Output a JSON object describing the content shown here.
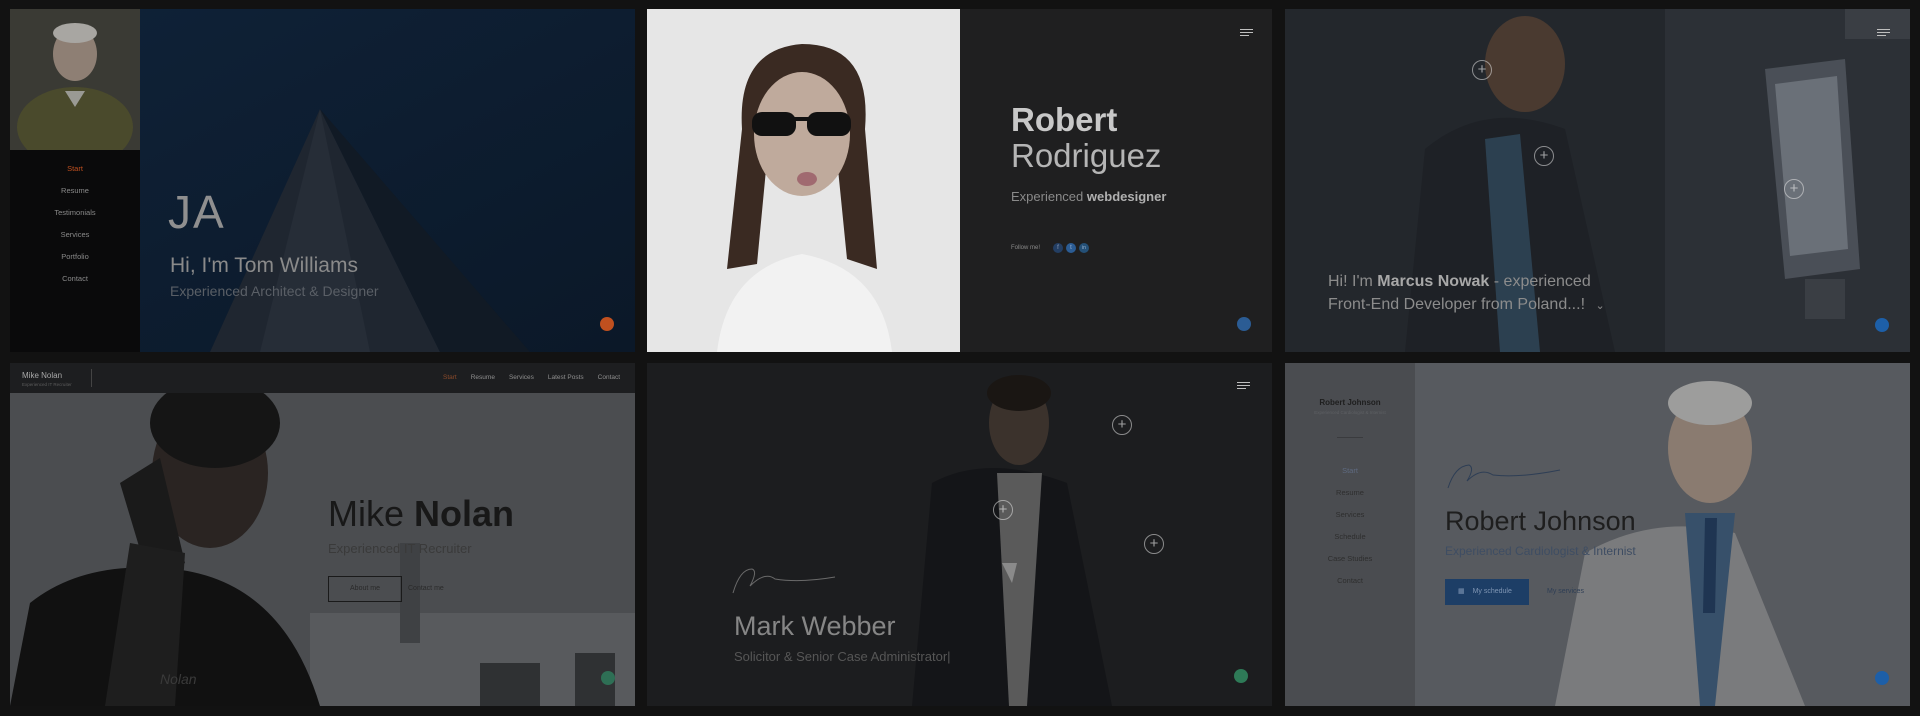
{
  "tiles": {
    "tom": {
      "nav": [
        "Start",
        "Resume",
        "Testimonials",
        "Services",
        "Portfolio",
        "Contact"
      ],
      "logo": "JA",
      "greeting": "Hi, I'm Tom Williams",
      "subtitle": "Experienced Architect & Designer",
      "colors": {
        "accent": "#c0501f"
      }
    },
    "robert_r": {
      "first_name": "Robert",
      "last_name": "Rodriguez",
      "role_prefix": "Experienced",
      "role": "webdesigner",
      "follow_label": "Follow me!",
      "social": [
        "f",
        "t",
        "in"
      ],
      "colors": {
        "accent": "#2b5c94"
      }
    },
    "marcus": {
      "greeting_prefix": "Hi! I'm",
      "name": "Marcus Nowak",
      "line1_suffix": "- experienced",
      "line2": "Front-End Developer from Poland...!",
      "arrow_icon": "chevron-down-icon"
    },
    "mike": {
      "header_name": "Mike Nolan",
      "header_sub": "Experienced IT Recruiter",
      "nav": [
        "Start",
        "Resume",
        "Services",
        "Latest Posts",
        "Contact"
      ],
      "first_name": "Mike",
      "last_name": "Nolan",
      "subtitle": "Experienced IT Recruiter",
      "btn_about": "About me",
      "btn_contact": "Contact me",
      "watermark": "Nolan"
    },
    "mark": {
      "name": "Mark Webber",
      "subtitle": "Solicitor & Senior Case Administrator|",
      "colors": {
        "accent": "#2e7a57"
      }
    },
    "robert_j": {
      "sidebar_name": "Robert Johnson",
      "sidebar_sub": "Experienced Cardiologist & Internist",
      "nav": [
        "Start",
        "Resume",
        "Services",
        "Schedule",
        "Case Studies",
        "Contact"
      ],
      "name": "Robert Johnson",
      "subtitle": "Experienced Cardiologist & Internist",
      "btn_schedule": "My schedule",
      "btn_services": "My services",
      "colors": {
        "accent": "#1d5fa8"
      }
    }
  }
}
